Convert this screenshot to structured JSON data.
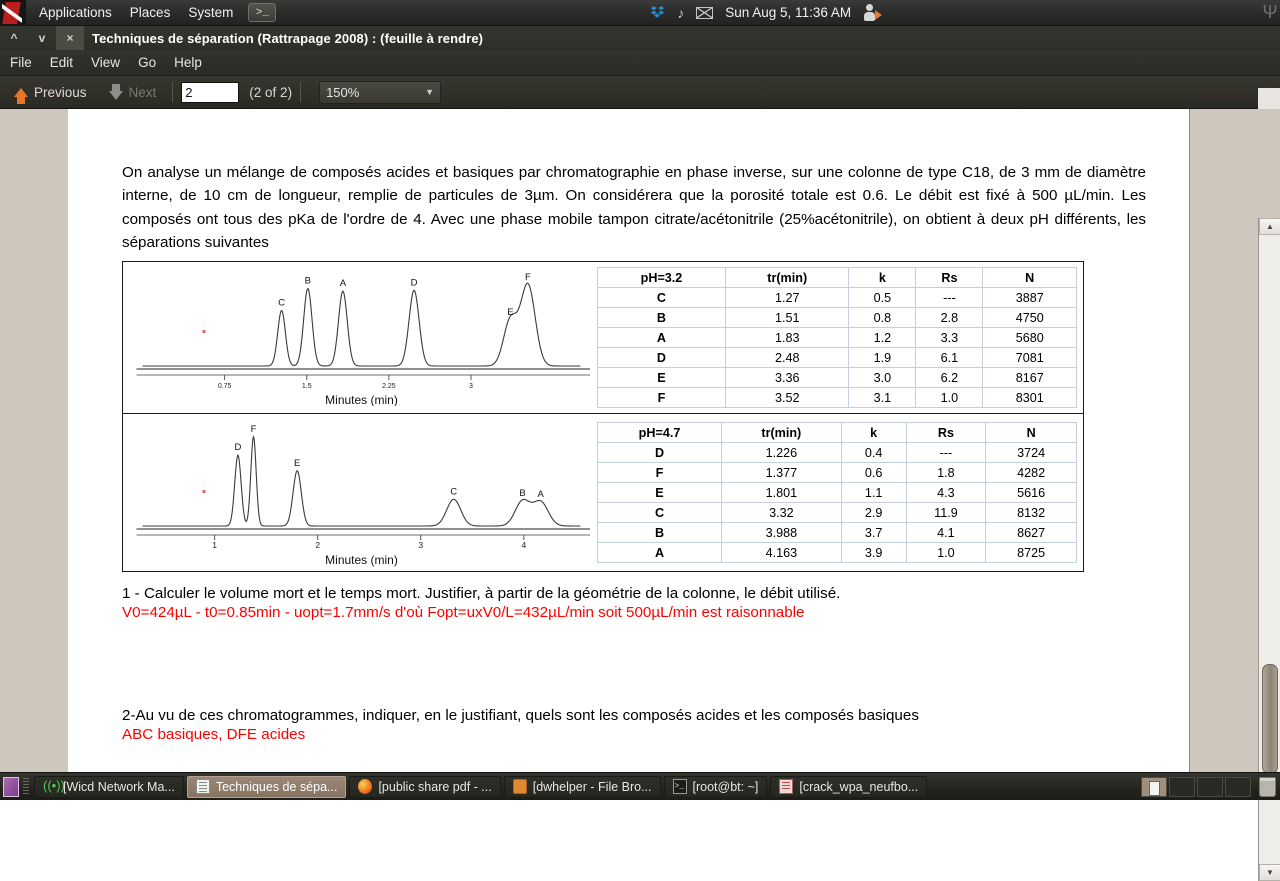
{
  "panel": {
    "menus": [
      "Applications",
      "Places",
      "System"
    ],
    "terminal_icon": "terminal-icon",
    "clock": "Sun Aug  5, 11:36 AM",
    "tray_icons": [
      "dropbox-icon",
      "volume-icon",
      "mail-icon",
      "user-account-icon"
    ]
  },
  "window": {
    "title": "Techniques de séparation (Rattrapage 2008) : (feuille à rendre)",
    "buttons": {
      "minimize": "^",
      "maximize": "v",
      "close": "×"
    }
  },
  "menubar": {
    "items": [
      "File",
      "Edit",
      "View",
      "Go",
      "Help"
    ]
  },
  "toolbar": {
    "previous_label": "Previous",
    "next_label": "Next",
    "page_value": "2",
    "page_count": "(2 of 2)",
    "zoom_value": "150%",
    "zoom_caret": "▼"
  },
  "document": {
    "intro": "On analyse un mélange de composés acides et basiques par chromatographie en phase inverse, sur une colonne de type C18, de 3 mm de diamètre interne, de 10 cm de longueur, remplie de particules de 3µm. On considérera que la porosité totale est 0.6. Le débit est fixé à 500 µL/min. Les  composés ont tous des pKa de l'ordre de 4. Avec une phase mobile tampon citrate/acétonitrile (25%acétonitrile), on obtient à deux pH différents, les séparations suivantes",
    "q1": "1 - Calculer le volume mort et le temps mort. Justifier, à partir de la géométrie de la colonne, le débit utilisé.",
    "a1": "V0=424µL - t0=0.85min - uopt=1.7mm/s d'où Fopt=uxV0/L=432µL/min soit 500µL/min est raisonnable",
    "q2": "2-Au vu de ces chromatogrammes, indiquer, en le justifiant, quels sont les composés acides et les composés basiques",
    "a2": "ABC basiques, DFE acides"
  },
  "chart_data": [
    {
      "type": "line",
      "title": "",
      "subtitle": "Chromatogramme pH=3.2",
      "xlabel": "Minutes (min)",
      "ylabel": "",
      "xlim": [
        0,
        4.0
      ],
      "xticks": [
        0.75,
        1.5,
        2.25,
        3
      ],
      "xticklabels": [
        "0.75",
        "1.5",
        "2.25",
        "3"
      ],
      "grid": false,
      "peaks": [
        {
          "label": "C",
          "x": 1.27,
          "height": 0.63,
          "width": 0.035
        },
        {
          "label": "B",
          "x": 1.51,
          "height": 0.88,
          "width": 0.038
        },
        {
          "label": "A",
          "x": 1.83,
          "height": 0.85,
          "width": 0.04
        },
        {
          "label": "D",
          "x": 2.48,
          "height": 0.86,
          "width": 0.046
        },
        {
          "label": "E",
          "x": 3.36,
          "height": 0.52,
          "width": 0.062
        },
        {
          "label": "F",
          "x": 3.52,
          "height": 0.92,
          "width": 0.066
        }
      ]
    },
    {
      "type": "line",
      "title": "",
      "subtitle": "Chromatogramme pH=4.7",
      "xlabel": "Minutes (min)",
      "ylabel": "",
      "xlim": [
        0.3,
        4.55
      ],
      "xticks": [
        1,
        2,
        3,
        4
      ],
      "xticklabels": [
        "1",
        "2",
        "3",
        "4"
      ],
      "grid": false,
      "peaks": [
        {
          "label": "D",
          "x": 1.226,
          "height": 0.77,
          "width": 0.031
        },
        {
          "label": "F",
          "x": 1.377,
          "height": 0.97,
          "width": 0.026
        },
        {
          "label": "E",
          "x": 1.801,
          "height": 0.6,
          "width": 0.04
        },
        {
          "label": "C",
          "x": 3.32,
          "height": 0.29,
          "width": 0.068
        },
        {
          "label": "B",
          "x": 3.988,
          "height": 0.27,
          "width": 0.072
        },
        {
          "label": "A",
          "x": 4.163,
          "height": 0.26,
          "width": 0.074
        }
      ]
    }
  ],
  "table_ph32": {
    "headers": [
      "pH=3.2",
      "tr(min)",
      "k",
      "Rs",
      "N"
    ],
    "rows": [
      [
        "C",
        "1.27",
        "0.5",
        "---",
        "3887"
      ],
      [
        "B",
        "1.51",
        "0.8",
        "2.8",
        "4750"
      ],
      [
        "A",
        "1.83",
        "1.2",
        "3.3",
        "5680"
      ],
      [
        "D",
        "2.48",
        "1.9",
        "6.1",
        "7081"
      ],
      [
        "E",
        "3.36",
        "3.0",
        "6.2",
        "8167"
      ],
      [
        "F",
        "3.52",
        "3.1",
        "1.0",
        "8301"
      ]
    ]
  },
  "table_ph47": {
    "headers": [
      "pH=4.7",
      "tr(min)",
      "k",
      "Rs",
      "N"
    ],
    "rows": [
      [
        "D",
        "1.226",
        "0.4",
        "---",
        "3724"
      ],
      [
        "F",
        "1.377",
        "0.6",
        "1.8",
        "4282"
      ],
      [
        "E",
        "1.801",
        "1.1",
        "4.3",
        "5616"
      ],
      [
        "C",
        "3.32",
        "2.9",
        "11.9",
        "8132"
      ],
      [
        "B",
        "3.988",
        "3.7",
        "4.1",
        "8627"
      ],
      [
        "A",
        "4.163",
        "3.9",
        "1.0",
        "8725"
      ]
    ]
  },
  "taskbar": {
    "tasks": [
      {
        "label": "[Wicd Network Ma...",
        "icon": "wifi-icon",
        "active": false
      },
      {
        "label": "Techniques de sépa...",
        "icon": "document-icon",
        "active": true
      },
      {
        "label": "[public share pdf - ...",
        "icon": "firefox-icon",
        "active": false
      },
      {
        "label": "[dwhelper - File Bro...",
        "icon": "folder-icon",
        "active": false
      },
      {
        "label": "[root@bt: ~]",
        "icon": "terminal-icon",
        "active": false
      },
      {
        "label": "[crack_wpa_neufbo...",
        "icon": "archive-icon",
        "active": false
      }
    ],
    "show_desktop": "show-desktop-icon",
    "trash": "trash-icon"
  },
  "colors": {
    "accent_orange": "#e8762a",
    "answer_red": "#ff0000",
    "panel_dark": "#2b2b29",
    "page_bg": "#cdc7bd",
    "active_task": "#87735f"
  }
}
